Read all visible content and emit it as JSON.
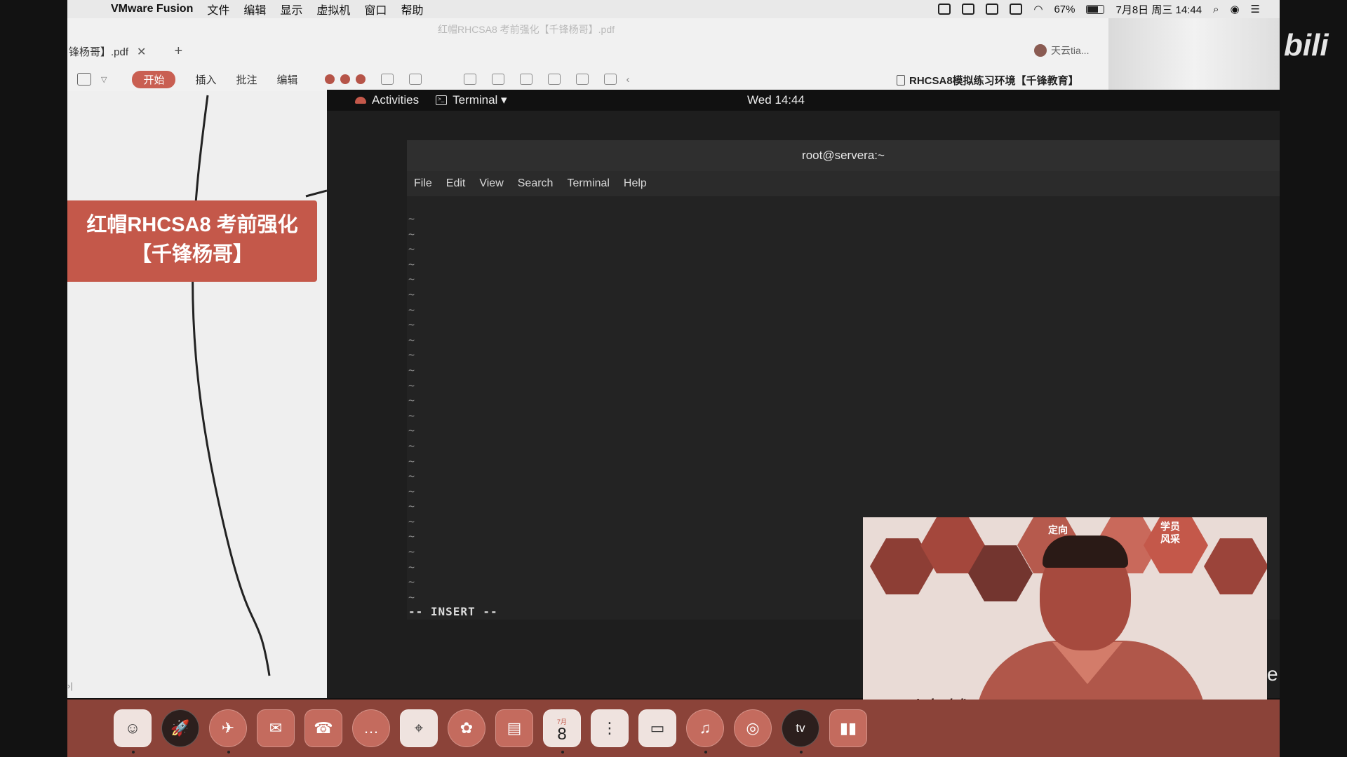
{
  "menubar": {
    "app_name": "VMware Fusion",
    "items": [
      "文件",
      "编辑",
      "显示",
      "虚拟机",
      "窗口",
      "帮助"
    ],
    "battery": "67%",
    "datetime": "7月8日 周三  14:44"
  },
  "pdf": {
    "doc_title": "红帽RHCSA8 考前强化【千锋杨哥】.pdf",
    "tab_label": "锋杨哥】.pdf",
    "user": "天云tia...",
    "start_label": "开始",
    "tabs": [
      "插入",
      "批注",
      "编辑"
    ],
    "card_text": "红帽RHCSA8 考前强化【千锋杨哥】"
  },
  "vmware": {
    "window_title": "RHCSA8模拟练习环境【千锋教育】"
  },
  "gnome": {
    "activities": "Activities",
    "app_menu": "Terminal ▾",
    "clock": "Wed 14:44"
  },
  "terminal": {
    "title": "root@servera:~",
    "menu": [
      "File",
      "Edit",
      "View",
      "Search",
      "Terminal",
      "Help"
    ],
    "tilde_char": "~",
    "tilde_count": 26,
    "mode_line": "-- INSERT --"
  },
  "camera": {
    "badge_1": "定向",
    "badge_2": "学员\n风采",
    "signature": "凡到卓越"
  },
  "dock": {
    "calendar_month": "7月",
    "calendar_day": "8",
    "apps": [
      "finder-icon",
      "launchpad-icon",
      "safari-icon",
      "mail-icon",
      "facetime-icon",
      "messages-icon",
      "maps-icon",
      "photos-icon",
      "notes-icon",
      "calendar-icon",
      "reminders-icon",
      "pages-icon",
      "music-icon",
      "podcasts-icon",
      "appletv-icon",
      "numbers-icon"
    ],
    "tv_label": "tv"
  },
  "overlay": {
    "watermark": "bili",
    "edge_letter": "e"
  },
  "colors": {
    "accent": "#c4584a",
    "terminal_bg": "#232323"
  }
}
